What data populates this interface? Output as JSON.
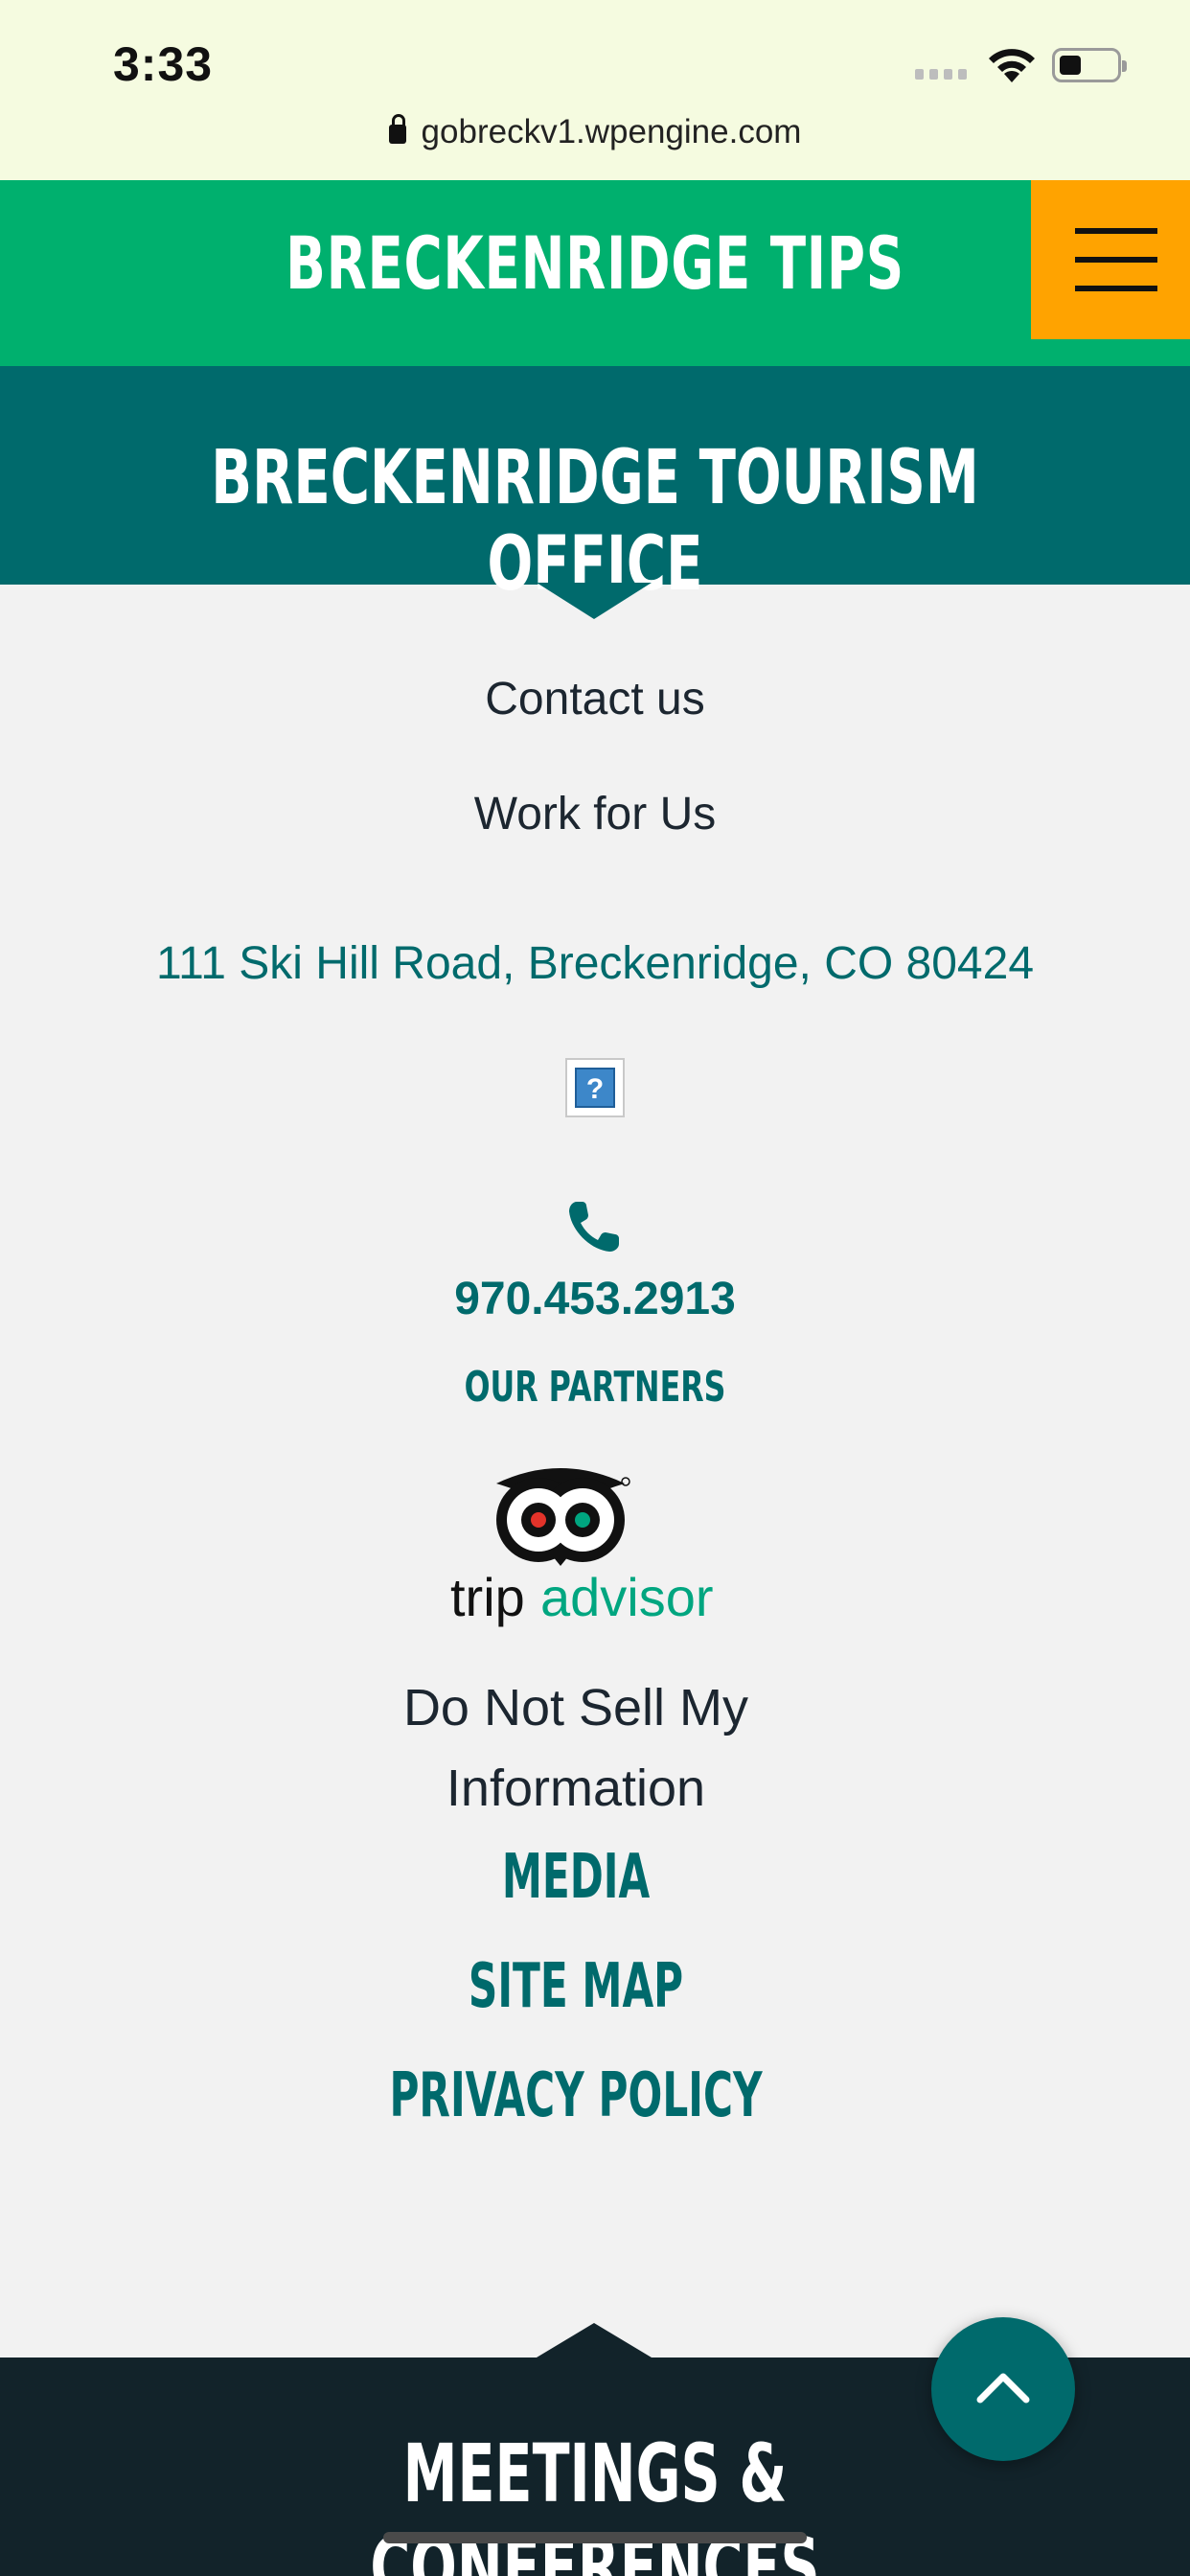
{
  "status_bar": {
    "time": "3:33",
    "url": "gobreckv1.wpengine.com"
  },
  "header": {
    "title": "BRECKENRIDGE TIPS",
    "menu_icon": "hamburger-menu-icon",
    "bg_color": "#00b06e",
    "menu_color": "#ffa300"
  },
  "office": {
    "title": "BRECKENRIDGE TOURISM OFFICE",
    "bg_color": "#006a6c"
  },
  "links": {
    "contact": "Contact us",
    "work": "Work for Us"
  },
  "address": "111 Ski Hill Road, Breckenridge, CO 80424",
  "broken_image_icon": "broken-image-icon",
  "phone": {
    "icon": "phone-icon",
    "number": "970.453.2913"
  },
  "partners": {
    "heading": "OUR PARTNERS",
    "logo_text_a": "trip",
    "logo_text_b": "advisor"
  },
  "footer_links": {
    "do_not_sell_1": "Do Not Sell My",
    "do_not_sell_2": "Information",
    "media": "MEDIA",
    "site_map": "SITE MAP",
    "privacy": "PRIVACY POLICY"
  },
  "meetings": {
    "title": "MEETINGS & CONFERENCES",
    "bg_color": "#12232a"
  },
  "back_to_top_icon": "chevron-up-icon"
}
